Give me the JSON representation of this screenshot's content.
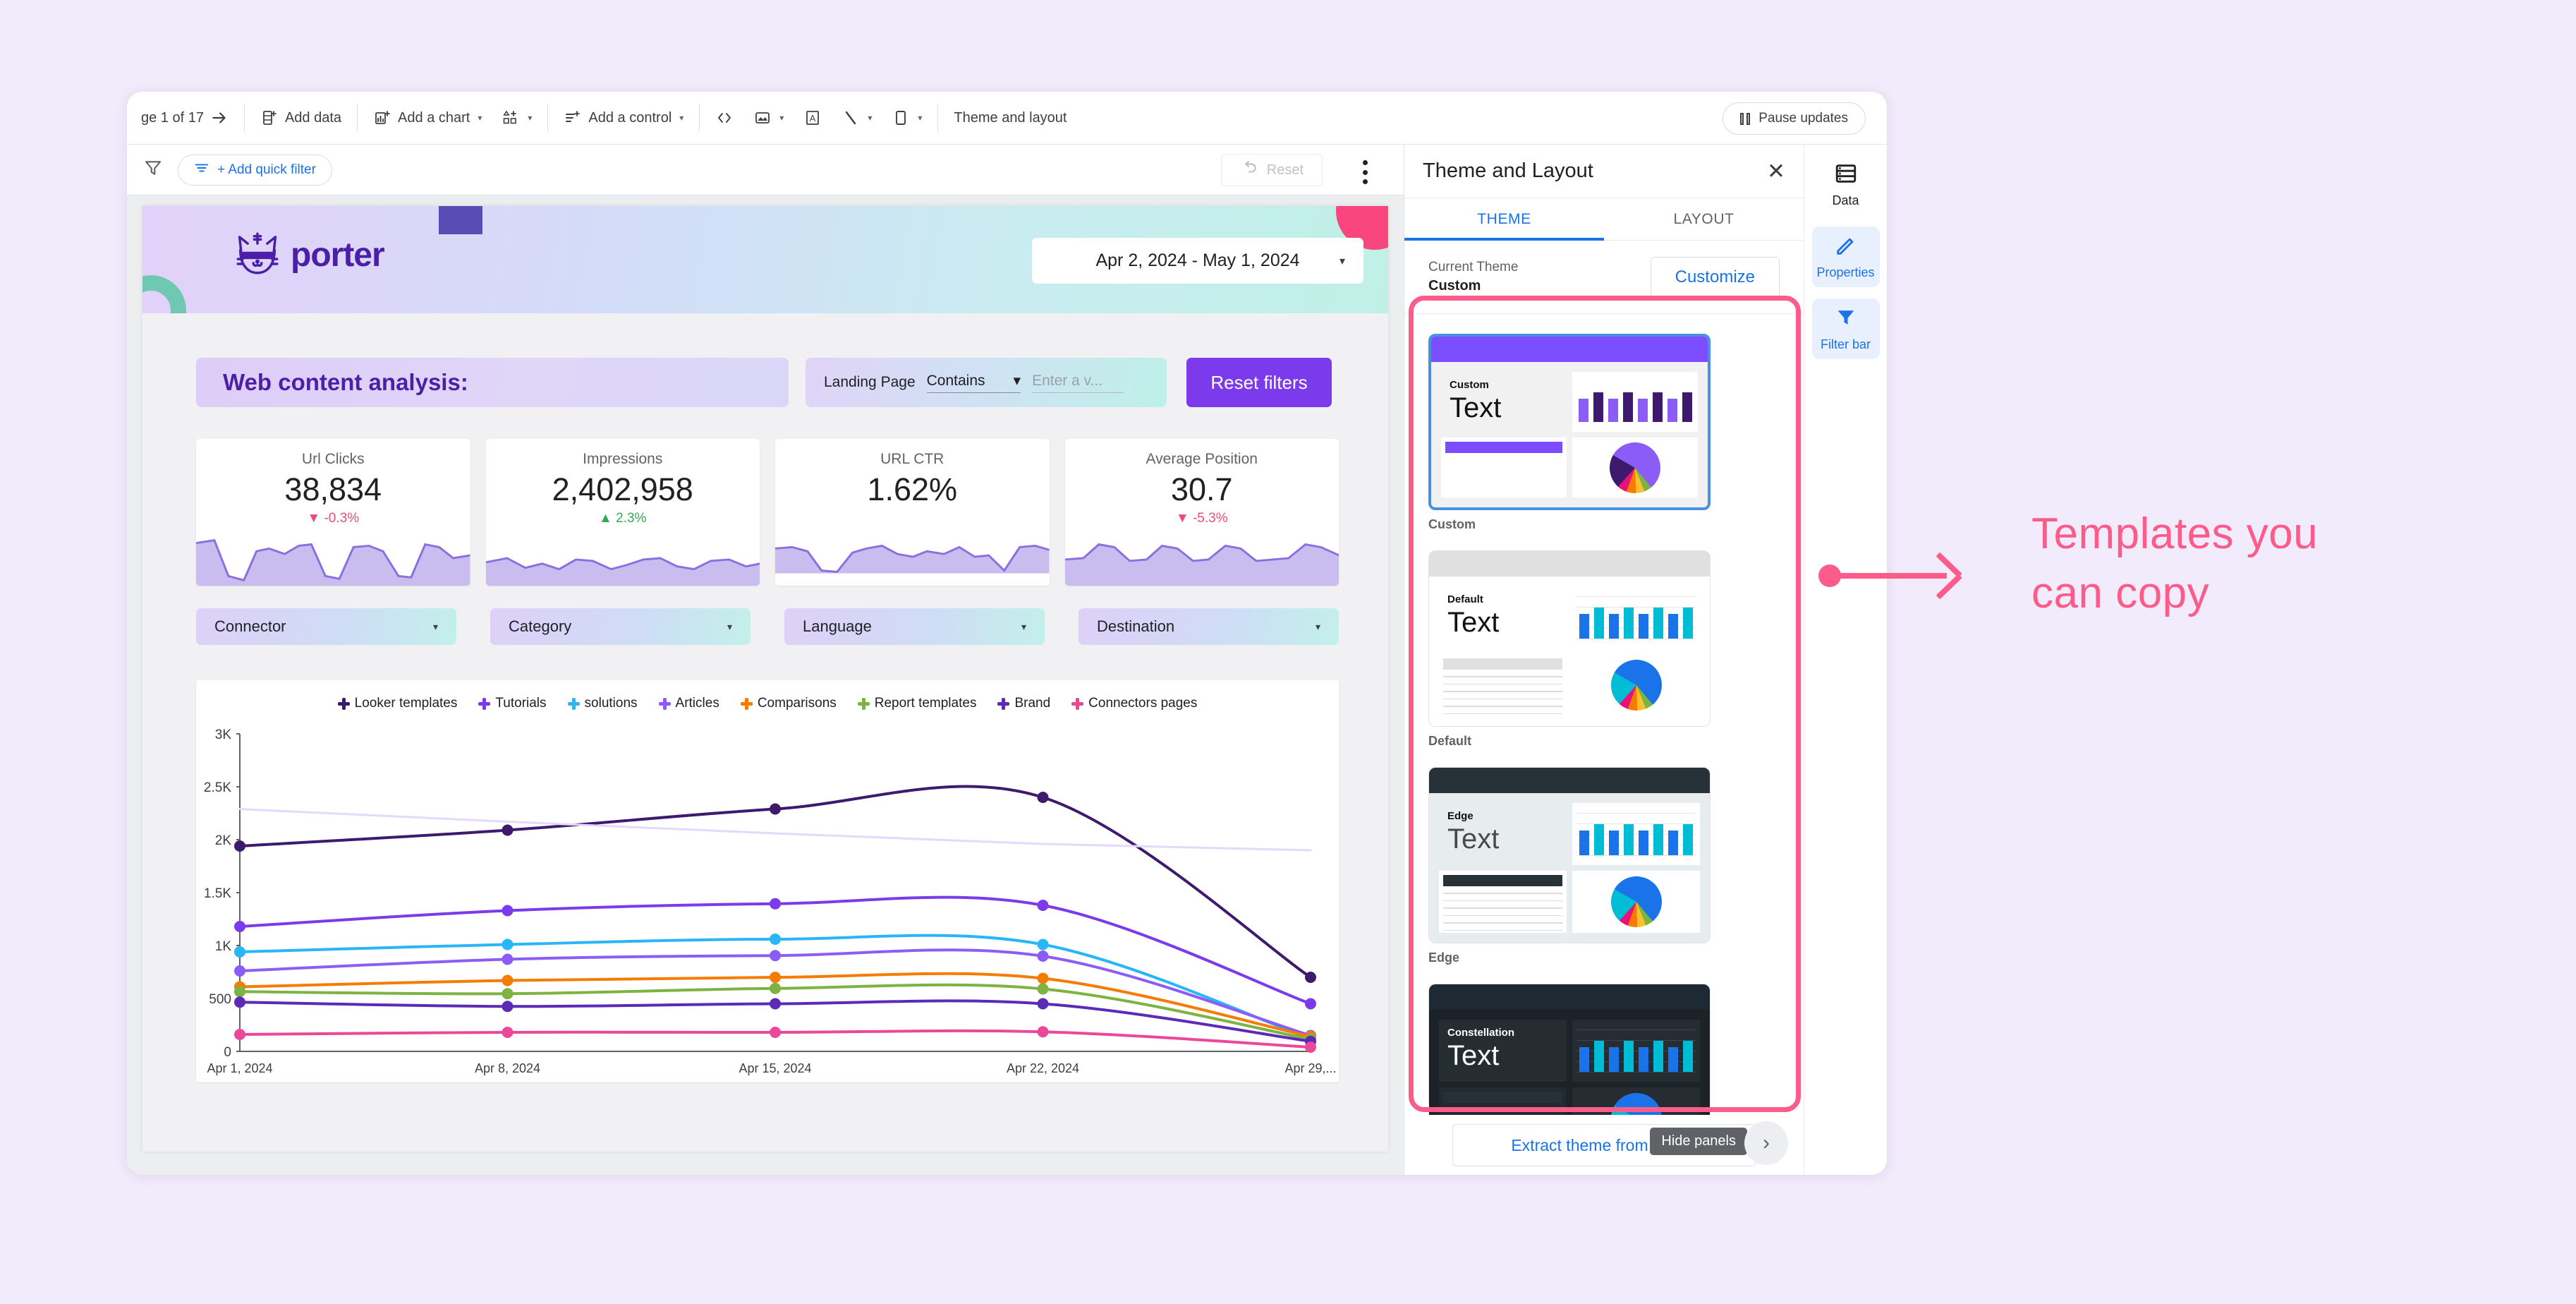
{
  "toolbar": {
    "page_indicator": "ge 1 of 17",
    "arrow_icon": "arrow-right-icon",
    "items": [
      {
        "label": "Add data",
        "icon": "add-data-icon",
        "caret": false
      },
      {
        "label": "Add a chart",
        "icon": "add-chart-icon",
        "caret": true
      },
      {
        "label": "",
        "icon": "add-community-viz-icon",
        "caret": true
      },
      {
        "label": "Add a control",
        "icon": "add-control-icon",
        "caret": true
      },
      {
        "label": "",
        "icon": "embed-code-icon",
        "caret": false
      },
      {
        "label": "",
        "icon": "image-icon",
        "caret": true
      },
      {
        "label": "",
        "icon": "text-box-icon",
        "caret": false
      },
      {
        "label": "",
        "icon": "line-icon",
        "caret": true
      },
      {
        "label": "",
        "icon": "shape-icon",
        "caret": true
      },
      {
        "label": "Theme and layout",
        "icon": "",
        "caret": false
      }
    ],
    "pause_updates": "Pause updates"
  },
  "filterbar": {
    "funnel_icon": "filter-icon",
    "add_quick_filter": "+ Add quick filter",
    "reset": "Reset",
    "reset_icon": "undo-icon",
    "more_icon": "kebab-menu-icon"
  },
  "report": {
    "brand": "porter",
    "logo_icon": "porter-cat-logo",
    "date_range": "Apr 2, 2024 - May 1, 2024",
    "title": "Web content analysis:",
    "landing_page_label": "Landing Page",
    "landing_page_condition": "Contains",
    "landing_page_placeholder": "Enter a v...",
    "reset_filters": "Reset filters",
    "scorecards": [
      {
        "label": "Url Clicks",
        "value": "38,834",
        "delta": "-0.3%",
        "dir": "down"
      },
      {
        "label": "Impressions",
        "value": "2,402,958",
        "delta": "2.3%",
        "dir": "up"
      },
      {
        "label": "URL CTR",
        "value": "1.62%",
        "delta": "",
        "dir": "none"
      },
      {
        "label": "Average Position",
        "value": "30.7",
        "delta": "-5.3%",
        "dir": "down"
      }
    ],
    "controls": [
      "Connector",
      "Category",
      "Language",
      "Destination"
    ]
  },
  "chart_data": {
    "type": "line",
    "title": "",
    "xlabel": "",
    "ylabel": "",
    "ylim": [
      0,
      3000
    ],
    "yticks": [
      0,
      500,
      1000,
      1500,
      2000,
      2500,
      3000
    ],
    "ytick_labels": [
      "0",
      "500",
      "1K",
      "1.5K",
      "2K",
      "2.5K",
      "3K"
    ],
    "x": [
      "Apr 1, 2024",
      "Apr 8, 2024",
      "Apr 15, 2024",
      "Apr 22, 2024",
      "Apr 29,..."
    ],
    "grid": false,
    "legend_position": "top",
    "series": [
      {
        "name": "Looker templates",
        "color": "#3d1a6e",
        "values": [
          1940,
          2090,
          2290,
          2400,
          700
        ]
      },
      {
        "name": "Tutorials",
        "color": "#7c3aed",
        "values": [
          1180,
          1330,
          1395,
          1380,
          450
        ]
      },
      {
        "name": "solutions",
        "color": "#29b6f6",
        "values": [
          940,
          1010,
          1060,
          1010,
          120
        ]
      },
      {
        "name": "Articles",
        "color": "#8b5cf6",
        "values": [
          760,
          870,
          905,
          900,
          150
        ]
      },
      {
        "name": "Comparisons",
        "color": "#f57c00",
        "values": [
          610,
          670,
          700,
          690,
          140
        ]
      },
      {
        "name": "Report templates",
        "color": "#7cb342",
        "values": [
          565,
          545,
          595,
          590,
          115
        ]
      },
      {
        "name": "Brand",
        "color": "#5b2bb8",
        "values": [
          465,
          425,
          450,
          450,
          95
        ]
      },
      {
        "name": "Connectors pages",
        "color": "#ec4899",
        "values": [
          160,
          180,
          180,
          185,
          40
        ]
      },
      {
        "name": "Trend",
        "color": "#e4d8fd",
        "values": [
          2290,
          2170,
          2060,
          1960,
          1900
        ]
      }
    ]
  },
  "panel": {
    "title": "Theme and Layout",
    "close_icon": "close-icon",
    "tabs": [
      {
        "label": "THEME",
        "active": true
      },
      {
        "label": "LAYOUT",
        "active": false
      }
    ],
    "current_theme_label": "Current Theme",
    "current_theme_value": "Custom",
    "customize": "Customize",
    "themes": [
      {
        "name": "Custom",
        "card_title": "Custom",
        "card_text": "Text",
        "selected": true,
        "bar": "#7c4dff",
        "bg": "#f1f1f1",
        "text_color": "#111111",
        "name_color": "#111111",
        "table_header": "#7c4dff",
        "table_bg": "#ffffff",
        "table_row": "#ffffff",
        "cell_bg": "#ffffff",
        "grid": false,
        "bars": [
          "#8b5cf6",
          "#3d1a6e",
          "#8b5cf6",
          "#3d1a6e",
          "#8b5cf6",
          "#3d1a6e",
          "#8b5cf6",
          "#3d1a6e"
        ],
        "pie": "conic-gradient(#8b5cf6 0deg 140deg, #7cb342 140deg 158deg, #fbc02d 158deg 178deg, #f57c00 178deg 200deg, #ec0f7a 200deg 222deg, #3d1a6e 222deg 300deg, #8b5cf6 300deg 360deg)"
      },
      {
        "name": "Default",
        "card_title": "Default",
        "card_text": "Text",
        "selected": false,
        "bar": "#e0e0e0",
        "bg": "#ffffff",
        "text_color": "#111111",
        "name_color": "#111111",
        "table_header": "#e0e0e0",
        "table_bg": "#ffffff",
        "table_row": "#dddddd",
        "cell_bg": "#ffffff",
        "grid": true,
        "bars": [
          "#1a73e8",
          "#00bcd4",
          "#1a73e8",
          "#00bcd4",
          "#1a73e8",
          "#00bcd4",
          "#1a73e8",
          "#00bcd4"
        ],
        "pie": "conic-gradient(#1a73e8 0deg 140deg, #7cb342 140deg 158deg, #fbc02d 158deg 178deg, #f57c00 178deg 200deg, #ec0f7a 200deg 222deg, #00bcd4 222deg 300deg, #1a73e8 300deg 360deg)"
      },
      {
        "name": "Edge",
        "card_title": "Edge",
        "card_text": "Text",
        "selected": false,
        "bar": "#263238",
        "bg": "#e7ecef",
        "text_color": "#4a4a4a",
        "name_color": "#111111",
        "table_header": "#263238",
        "table_bg": "#ffffff",
        "table_row": "#dddddd",
        "cell_bg": "#ffffff",
        "grid": true,
        "bars": [
          "#1a73e8",
          "#00bcd4",
          "#1a73e8",
          "#00bcd4",
          "#1a73e8",
          "#00bcd4",
          "#1a73e8",
          "#00bcd4"
        ],
        "pie": "conic-gradient(#1a73e8 0deg 140deg, #7cb342 140deg 158deg, #fbc02d 158deg 178deg, #f57c00 178deg 200deg, #ec0f7a 200deg 222deg, #00bcd4 222deg 300deg, #1a73e8 300deg 360deg)"
      },
      {
        "name": "Constellation",
        "card_title": "Constellation",
        "card_text": "Text",
        "selected": false,
        "bar": "#1e2a33",
        "bg": "#1c2227",
        "text_color": "#ffffff",
        "name_color": "#ffffff",
        "table_header": "#253039",
        "table_bg": "#222a30",
        "table_row": "#33404a",
        "cell_bg": "#252d33",
        "grid": true,
        "bars": [
          "#1a73e8",
          "#00bcd4",
          "#1a73e8",
          "#00bcd4",
          "#1a73e8",
          "#00bcd4",
          "#1a73e8",
          "#00bcd4"
        ],
        "pie": "conic-gradient(#1a73e8 0deg 140deg, #7cb342 140deg 158deg, #fbc02d 158deg 178deg, #f57c00 178deg 200deg, #ec0f7a 200deg 222deg, #00bcd4 222deg 300deg, #1a73e8 300deg 360deg)"
      }
    ],
    "extract_theme": "Extract theme from image",
    "hide_panels_tooltip": "Hide panels",
    "expand_icon": "chevron-right-icon"
  },
  "rail": [
    {
      "label": "Data",
      "icon": "data-icon",
      "active": false
    },
    {
      "label": "Properties",
      "icon": "pencil-icon",
      "active": true
    },
    {
      "label": "Filter bar",
      "icon": "filter-icon",
      "active": true
    }
  ],
  "annotation": {
    "text_line1": "Templates you",
    "text_line2": "can copy",
    "color": "#fb5c8a"
  }
}
